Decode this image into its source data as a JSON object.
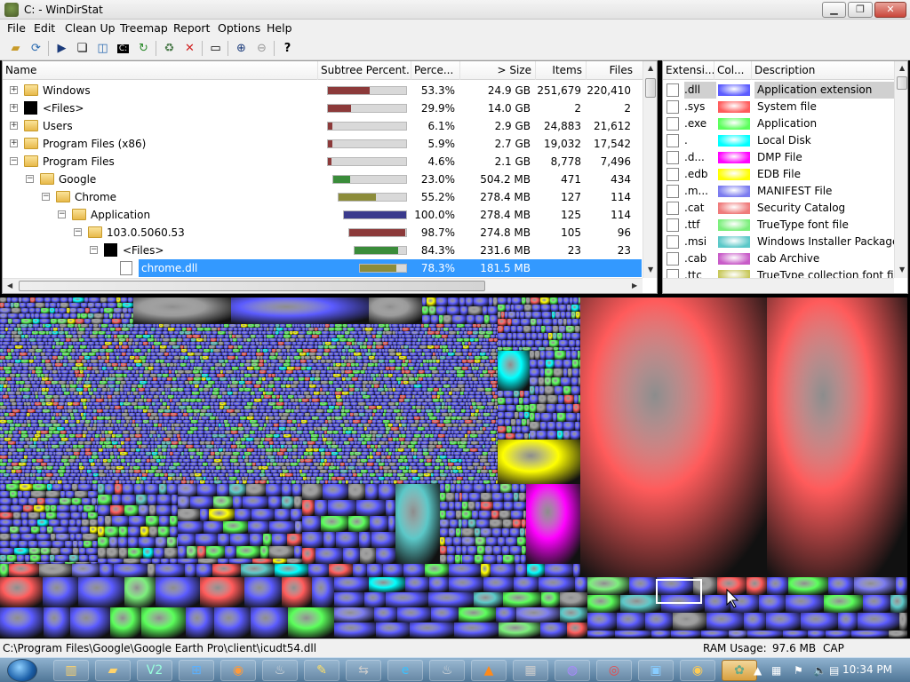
{
  "window": {
    "title": "C: - WinDirStat",
    "min_icon": "minimize-icon",
    "max_icon": "maximize-icon",
    "close_icon": "close-icon"
  },
  "menu": [
    "File",
    "Edit",
    "Clean Up",
    "Treemap",
    "Report",
    "Options",
    "Help"
  ],
  "toolbar": {
    "icons": [
      "open-icon",
      "refresh-all-icon",
      "play-icon",
      "copy-path-icon",
      "explorer-icon",
      "command-prompt-icon",
      "refresh-selected-icon",
      "recycle-bin-icon",
      "delete-icon",
      "properties-icon",
      "zoom-in-icon",
      "zoom-out-icon",
      "help-icon"
    ]
  },
  "tree": {
    "columns": [
      "Name",
      "Subtree Percent...",
      "Perce...",
      "> Size",
      "Items",
      "Files"
    ],
    "rows": [
      {
        "name": "Windows",
        "icon": "folder-icon",
        "expander": "+",
        "depth": 0,
        "bar_fraction": 0.533,
        "bar_color": "#8c3a3a",
        "percent": "53.3%",
        "size": "24.9 GB",
        "items": "251,679",
        "files": "220,410"
      },
      {
        "name": "<Files>",
        "icon": "black-square-icon",
        "expander": "+",
        "depth": 0,
        "bar_fraction": 0.299,
        "bar_color": "#8c3a3a",
        "percent": "29.9%",
        "size": "14.0 GB",
        "items": "2",
        "files": "2"
      },
      {
        "name": "Users",
        "icon": "folder-icon",
        "expander": "+",
        "depth": 0,
        "bar_fraction": 0.061,
        "bar_color": "#8c3a3a",
        "percent": "6.1%",
        "size": "2.9 GB",
        "items": "24,883",
        "files": "21,612"
      },
      {
        "name": "Program Files (x86)",
        "icon": "folder-icon",
        "expander": "+",
        "depth": 0,
        "bar_fraction": 0.059,
        "bar_color": "#8c3a3a",
        "percent": "5.9%",
        "size": "2.7 GB",
        "items": "19,032",
        "files": "17,542"
      },
      {
        "name": "Program Files",
        "icon": "folder-icon",
        "expander": "-",
        "depth": 0,
        "bar_fraction": 0.046,
        "bar_color": "#8c3a3a",
        "percent": "4.6%",
        "size": "2.1 GB",
        "items": "8,778",
        "files": "7,496"
      },
      {
        "name": "Google",
        "icon": "folder-icon",
        "expander": "-",
        "depth": 1,
        "bar_fraction": 0.23,
        "bar_color": "#3a8c3a",
        "percent": "23.0%",
        "size": "504.2 MB",
        "items": "471",
        "files": "434"
      },
      {
        "name": "Chrome",
        "icon": "folder-icon",
        "expander": "-",
        "depth": 2,
        "bar_fraction": 0.552,
        "bar_color": "#8c8c3a",
        "percent": "55.2%",
        "size": "278.4 MB",
        "items": "127",
        "files": "114"
      },
      {
        "name": "Application",
        "icon": "folder-icon",
        "expander": "-",
        "depth": 3,
        "bar_fraction": 1.0,
        "bar_color": "#3a3a8c",
        "percent": "100.0%",
        "size": "278.4 MB",
        "items": "125",
        "files": "114"
      },
      {
        "name": "103.0.5060.53",
        "icon": "folder-icon",
        "expander": "-",
        "depth": 4,
        "bar_fraction": 0.987,
        "bar_color": "#8c3a3a",
        "percent": "98.7%",
        "size": "274.8 MB",
        "items": "105",
        "files": "96"
      },
      {
        "name": "<Files>",
        "icon": "black-square-icon",
        "expander": "-",
        "depth": 5,
        "bar_fraction": 0.843,
        "bar_color": "#3a8c3a",
        "percent": "84.3%",
        "size": "231.6 MB",
        "items": "23",
        "files": "23"
      },
      {
        "name": "chrome.dll",
        "icon": "dll-file-icon",
        "expander": "",
        "depth": 6,
        "bar_fraction": 0.783,
        "bar_color": "#8c8c3a",
        "percent": "78.3%",
        "size": "181.5 MB",
        "items": "",
        "files": "",
        "selected": true
      }
    ]
  },
  "extensions": {
    "columns": [
      "Extensi...",
      "Col...",
      "Description"
    ],
    "rows": [
      {
        "ext": ".dll",
        "color": "#5b5bff",
        "description": "Application extension",
        "selected": true
      },
      {
        "ext": ".sys",
        "color": "#ff5b5b",
        "description": "System file"
      },
      {
        "ext": ".exe",
        "color": "#5bff5b",
        "description": "Application"
      },
      {
        "ext": ".",
        "color": "#00ffff",
        "description": "Local Disk"
      },
      {
        "ext": ".d...",
        "color": "#ff00ff",
        "description": "DMP File"
      },
      {
        "ext": ".edb",
        "color": "#ffff00",
        "description": "EDB File"
      },
      {
        "ext": ".m...",
        "color": "#7b7bef",
        "description": "MANIFEST File"
      },
      {
        "ext": ".cat",
        "color": "#ef7b7b",
        "description": "Security Catalog"
      },
      {
        "ext": ".ttf",
        "color": "#7bef7b",
        "description": "TrueType font file"
      },
      {
        "ext": ".msi",
        "color": "#5bc8c8",
        "description": "Windows Installer Package"
      },
      {
        "ext": ".cab",
        "color": "#c85bc8",
        "description": "cab Archive"
      },
      {
        "ext": ".ttc",
        "color": "#c8c85b",
        "description": "TrueType collection font file"
      }
    ]
  },
  "status": {
    "path": "C:\\Program Files\\Google\\Google Earth Pro\\client\\icudt54.dll",
    "ram_usage": "RAM Usage:",
    "ram_value": "97.6 MB",
    "cap": "CAP"
  },
  "taskbar": {
    "icons": [
      "file-explorer-icon",
      "folder-icon",
      "vpn-icon",
      "windows-icon",
      "firefox-icon",
      "steam-icon",
      "pencil-icon",
      "network-icon",
      "edge-icon",
      "steam-logo-icon",
      "vlc-icon",
      "calculator-icon",
      "headphones-icon",
      "chrome-icon",
      "remote-desktop-icon",
      "winamp-icon",
      "windirstat-icon"
    ],
    "clock": "10:34 PM"
  }
}
